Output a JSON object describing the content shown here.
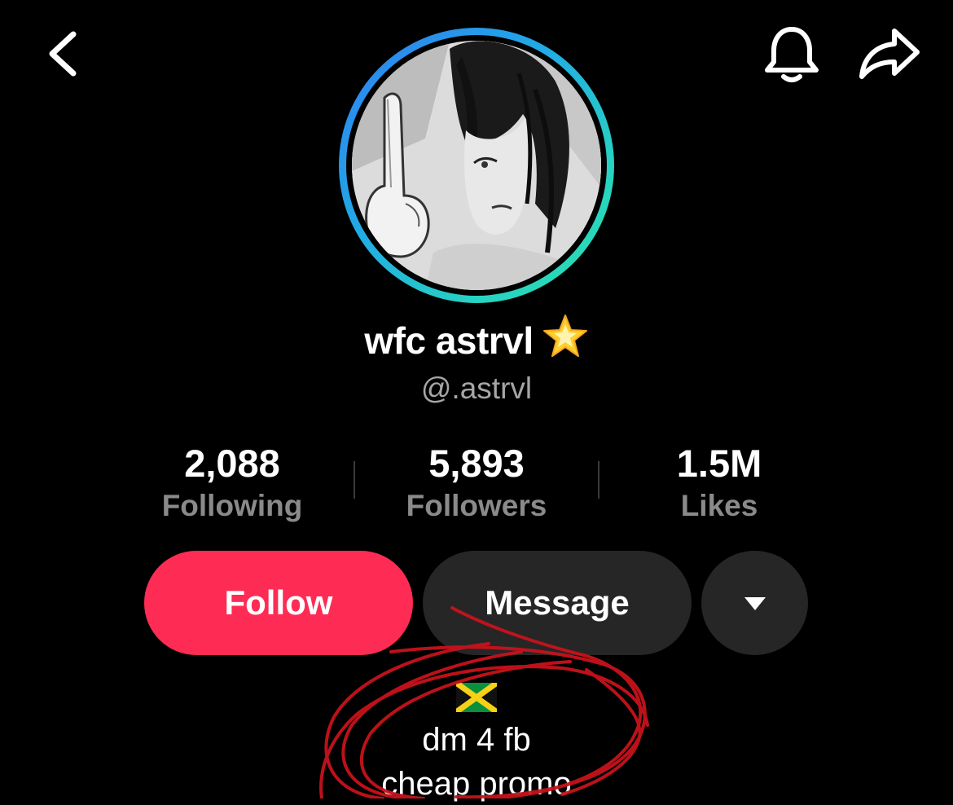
{
  "profile": {
    "display_name": "wfc astrvl",
    "handle": "@.astrvl",
    "badge_icon": "glowing-star-emoji",
    "avatar_icon": "manga-character-avatar"
  },
  "stats": {
    "following": {
      "value": "2,088",
      "label": "Following"
    },
    "followers": {
      "value": "5,893",
      "label": "Followers"
    },
    "likes": {
      "value": "1.5M",
      "label": "Likes"
    }
  },
  "actions": {
    "follow_label": "Follow",
    "message_label": "Message",
    "more_icon": "triangle-down-icon"
  },
  "bio": {
    "flag_icon": "jamaica-flag",
    "line1": "dm 4 fb",
    "line2": "cheap promo"
  },
  "nav": {
    "back_icon": "chevron-left-icon",
    "bell_icon": "bell-icon",
    "share_icon": "share-arrow-icon"
  },
  "colors": {
    "follow_button": "#fe2c55",
    "secondary_button": "#262626",
    "ring_gradient_start": "#2f7cf0",
    "ring_gradient_end": "#2be0a8",
    "annotation_scribble": "#c8121c"
  }
}
